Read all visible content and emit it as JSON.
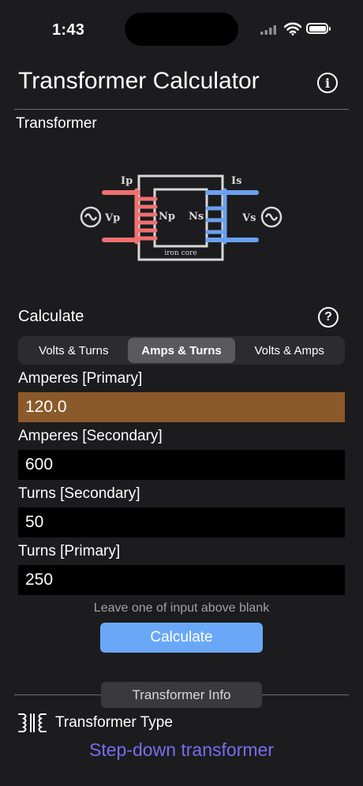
{
  "status_bar": {
    "time": "1:43"
  },
  "header": {
    "title": "Transformer Calculator"
  },
  "section": {
    "label": "Transformer"
  },
  "diagram": {
    "labels": {
      "ip": "Ip",
      "vp": "Vp",
      "np": "Np",
      "ns": "Ns",
      "is": "Is",
      "vs": "Vs",
      "core": "iron core"
    },
    "colors": {
      "primary": "#f07070",
      "secondary": "#6aa0f0",
      "core": "#d8d8d8"
    }
  },
  "calculate": {
    "label": "Calculate",
    "tabs": [
      "Volts & Turns",
      "Amps & Turns",
      "Volts & Amps"
    ],
    "selected_tab": "Amps & Turns"
  },
  "fields": [
    {
      "label": "Amperes [Primary]",
      "value": "120.0"
    },
    {
      "label": "Amperes [Secondary]",
      "value": "600"
    },
    {
      "label": "Turns [Secondary]",
      "value": "50"
    },
    {
      "label": "Turns [Primary]",
      "value": "250"
    }
  ],
  "hint": "Leave one of input above blank",
  "calculate_button": "Calculate",
  "info": {
    "pill_label": "Transformer Info",
    "type_label": "Transformer Type",
    "type_value": "Step-down transformer"
  }
}
